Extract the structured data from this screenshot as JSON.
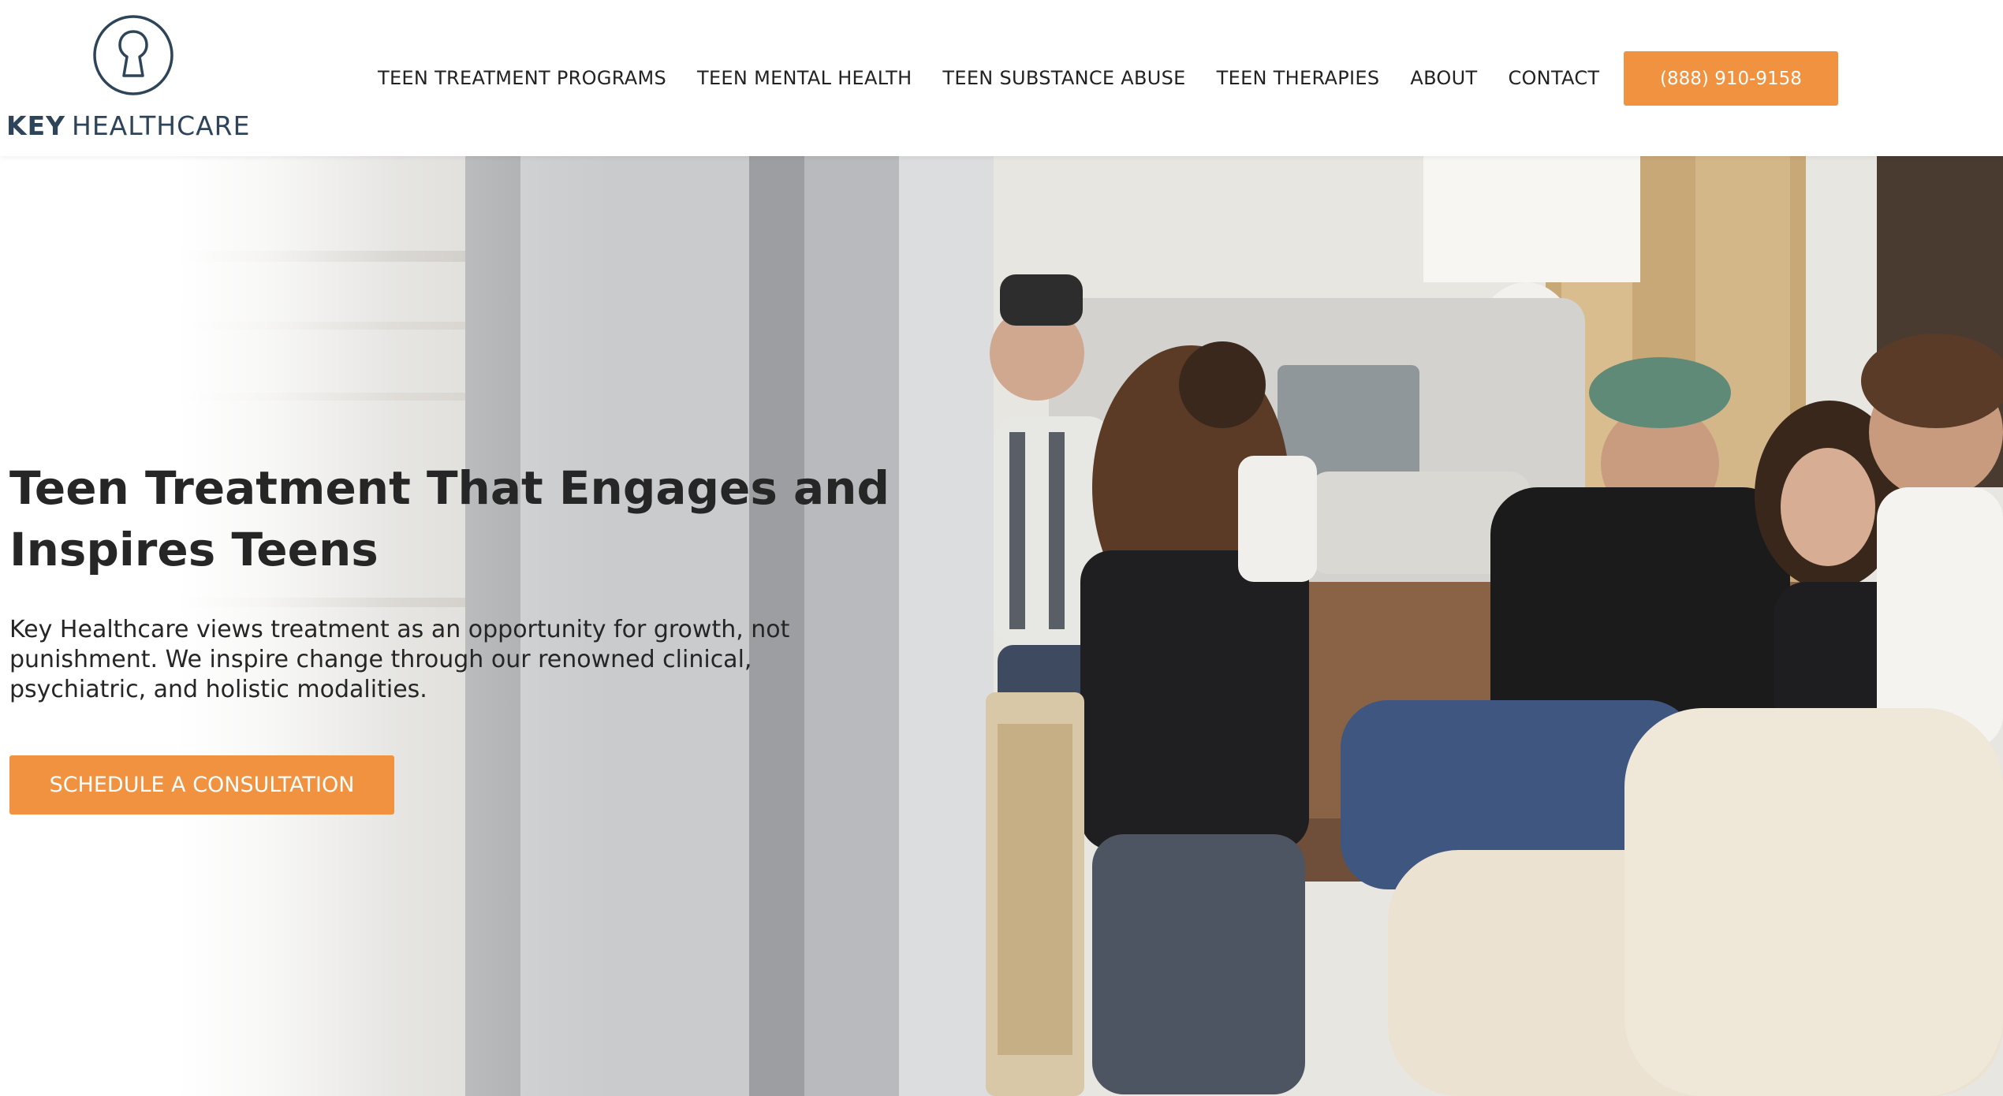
{
  "brand": {
    "logo_icon": "keyhole-icon",
    "name_bold": "KEY",
    "name_regular": "HEALTHCARE",
    "primary_color": "#2e4459",
    "accent_color": "#f0923f"
  },
  "nav": {
    "items": [
      {
        "label": "TEEN TREATMENT PROGRAMS"
      },
      {
        "label": "TEEN MENTAL HEALTH"
      },
      {
        "label": "TEEN SUBSTANCE ABUSE"
      },
      {
        "label": "TEEN THERAPIES"
      },
      {
        "label": "ABOUT"
      },
      {
        "label": "CONTACT"
      }
    ],
    "phone_label": "(888) 910-9158"
  },
  "hero": {
    "title": "Teen Treatment That Engages and Inspires Teens",
    "description": "Key Healthcare views treatment as an opportunity for growth, not punishment. We inspire change through our renowned clinical, psychiatric, and holistic modalities.",
    "cta_label": "SCHEDULE A CONSULTATION"
  }
}
